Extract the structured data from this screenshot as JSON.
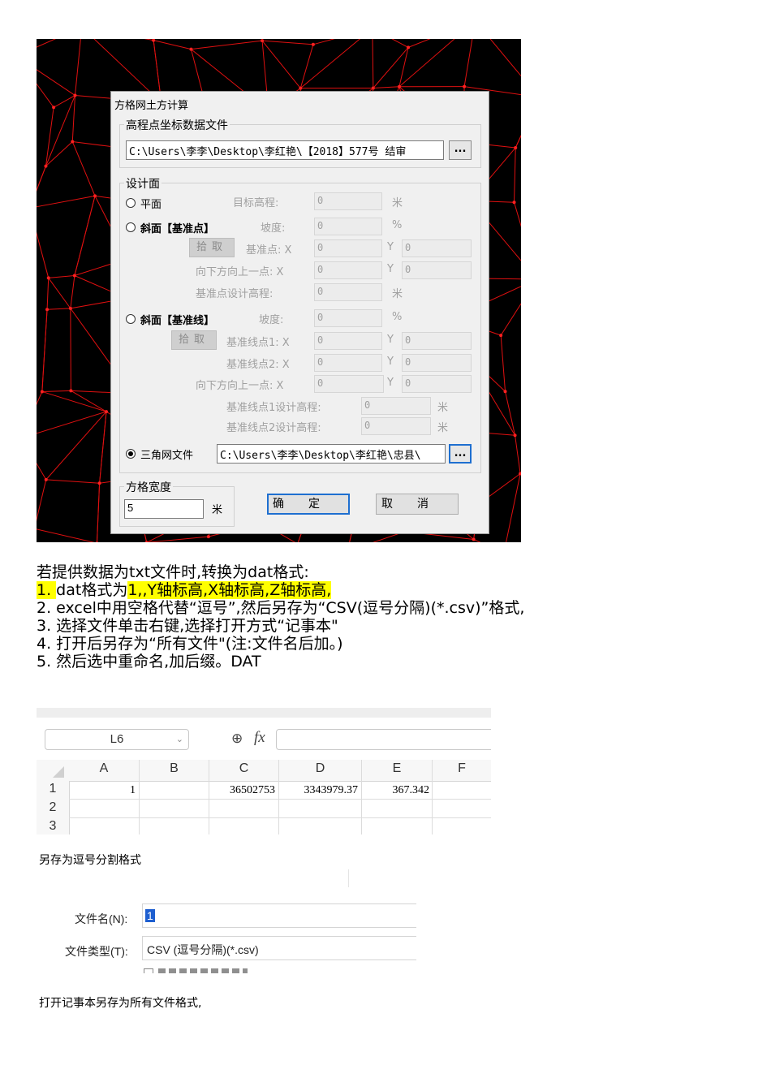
{
  "dialog": {
    "title": "方格网土方计算",
    "data_file": {
      "group_label": "高程点坐标数据文件",
      "path": "C:\\Users\\李李\\Desktop\\李红艳\\【2018】577号 结审",
      "browse_label": "..."
    },
    "design": {
      "group_label": "设计面",
      "plane": {
        "label": "平面",
        "target_label": "目标高程:",
        "target_value": "0",
        "unit": "米"
      },
      "slope_point": {
        "label": "斜面【基准点】",
        "slope_label": "坡度:",
        "slope_value": "0",
        "slope_unit": "%",
        "pick_label": "拾取",
        "base_label": "基准点: X",
        "base_x": "0",
        "y_label": "Y",
        "base_y": "0",
        "down_label": "向下方向上一点: X",
        "down_x": "0",
        "down_y": "0",
        "elev_label": "基准点设计高程:",
        "elev_value": "0",
        "elev_unit": "米"
      },
      "slope_line": {
        "label": "斜面【基准线】",
        "slope_label": "坡度:",
        "slope_value": "0",
        "slope_unit": "%",
        "pick_label": "拾取",
        "p1_label": "基准线点1: X",
        "p1_x": "0",
        "p1_y": "0",
        "p2_label": "基准线点2: X",
        "p2_x": "0",
        "p2_y": "0",
        "down_label": "向下方向上一点: X",
        "down_x": "0",
        "down_y": "0",
        "p1_elev_label": "基准线点1设计高程:",
        "p1_elev_value": "0",
        "p2_elev_label": "基准线点2设计高程:",
        "p2_elev_value": "0",
        "unit": "米"
      },
      "tin": {
        "label": "三角网文件",
        "path": "C:\\Users\\李李\\Desktop\\李红艳\\忠县\\",
        "browse_label": "..."
      }
    },
    "grid": {
      "group_label": "方格宽度",
      "value": "5",
      "unit": "米"
    },
    "ok_label": "确定",
    "cancel_label": "取消"
  },
  "instructions": {
    "intro": "若提供数据为txt文件时,转换为dat格式:",
    "step1_prefix": "1. ",
    "step1_body": "dat格式为",
    "step1_highlight": "1,,Y轴标高,X轴标高,Z轴标高,",
    "step2": "2. excel中用空格代替“逗号”,然后另存为“CSV(逗号分隔)(*.csv)”格式,",
    "step3": "3. 选择文件单击右键,选择打开方式“记事本\"",
    "step4": "4. 打开后另存为“所有文件\"(注:文件名后加。)",
    "step5": "5. 然后选中重命名,加后缀。DAT"
  },
  "spreadsheet": {
    "name_box": "L6",
    "fx_label": "fx",
    "columns": [
      "A",
      "B",
      "C",
      "D",
      "E",
      "F"
    ],
    "rows": [
      "1",
      "2",
      "3"
    ],
    "row1": [
      "1",
      "",
      "36502753",
      "3343979.37",
      "367.342",
      ""
    ]
  },
  "caption_save": "另存为逗号分割格式",
  "save_dialog": {
    "filename_label": "文件名(N):",
    "filename_value": "1",
    "type_label": "文件类型(T):",
    "type_value": "CSV (逗号分隔)(*.csv)"
  },
  "caption_notepad": "打开记事本另存为所有文件格式,"
}
